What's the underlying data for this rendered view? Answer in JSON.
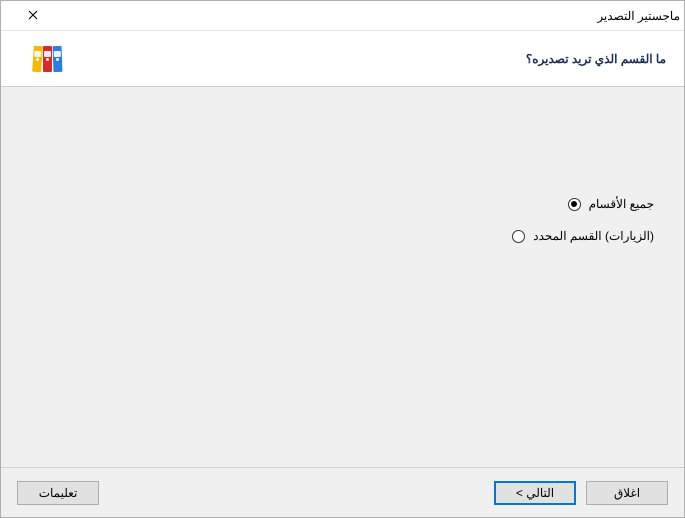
{
  "window": {
    "title": "ماجستير التصدير"
  },
  "header": {
    "question": "ما القسم الذي تريد تصديره؟"
  },
  "options": {
    "all": {
      "label": "جميع الأقسام",
      "selected": true
    },
    "selected_section": {
      "label": "(الزيارات) القسم المحدد",
      "selected": false
    }
  },
  "footer": {
    "help": "تعليمات",
    "next": "التالي >",
    "close": "اغلاق"
  },
  "icons": {
    "close": "close-icon",
    "binders": "folders-icon"
  }
}
